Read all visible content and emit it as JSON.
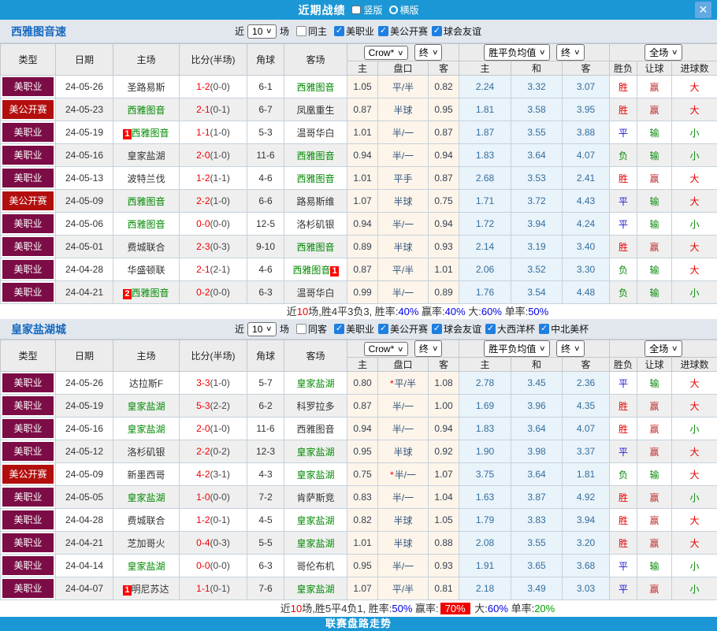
{
  "icons": {
    "chevron": "∨",
    "close": "✕",
    "check": "✓"
  },
  "titlebar": {
    "title": "近期战绩",
    "radios": [
      {
        "label": "竖版",
        "selected": true
      },
      {
        "label": "横版",
        "selected": false
      }
    ]
  },
  "table_header": {
    "main_cols": [
      "类型",
      "日期",
      "主场",
      "比分(半场)",
      "角球",
      "客场"
    ],
    "selects": {
      "crow": "Crow*",
      "crow_end": "终",
      "mean": "胜平负均值",
      "mean_end": "终",
      "full": "全场"
    },
    "sub_cols": [
      "主",
      "盘口",
      "客",
      "主",
      "和",
      "客",
      "胜负",
      "让球",
      "进球数"
    ]
  },
  "outcome_colors": {
    "胜": "red",
    "平": "blue",
    "负": "green",
    "赢": "brick",
    "输": "green",
    "大": "red",
    "小": "green"
  },
  "sections": [
    {
      "team": "西雅图音速",
      "filters": {
        "near": "近",
        "count": "10",
        "unit": "场",
        "same": {
          "label": "同主",
          "checked": false
        },
        "leagues": [
          {
            "label": "美职业",
            "checked": true
          },
          {
            "label": "美公开赛",
            "checked": true
          },
          {
            "label": "球会友谊",
            "checked": true
          }
        ]
      },
      "rows": [
        {
          "type": "美职业",
          "type_style": "maroon",
          "date": "24-05-26",
          "home": {
            "name": "圣路易斯",
            "green": false
          },
          "score": "1-2",
          "half": "(0-0)",
          "corners": "6-1",
          "away": {
            "name": "西雅图音",
            "green": true
          },
          "crow": [
            "1.05",
            "平/半",
            "0.82"
          ],
          "crow_star": false,
          "mean": [
            "2.24",
            "3.32",
            "3.07"
          ],
          "outcome": [
            "胜",
            "赢",
            "大"
          ]
        },
        {
          "type": "美公开赛",
          "type_style": "red",
          "date": "24-05-23",
          "home": {
            "name": "西雅图音",
            "green": true
          },
          "score": "2-1",
          "half": "(0-1)",
          "corners": "6-7",
          "away": {
            "name": "凤凰重生",
            "green": false
          },
          "crow": [
            "0.87",
            "半球",
            "0.95"
          ],
          "crow_star": false,
          "mean": [
            "1.81",
            "3.58",
            "3.95"
          ],
          "outcome": [
            "胜",
            "赢",
            "大"
          ]
        },
        {
          "type": "美职业",
          "type_style": "maroon",
          "date": "24-05-19",
          "home": {
            "name": "西雅图音",
            "green": true,
            "badge": "1",
            "badge_pos": "before"
          },
          "score": "1-1",
          "half": "(1-0)",
          "corners": "5-3",
          "away": {
            "name": "温哥华白",
            "green": false
          },
          "crow": [
            "1.01",
            "半/一",
            "0.87"
          ],
          "crow_star": false,
          "mean": [
            "1.87",
            "3.55",
            "3.88"
          ],
          "outcome": [
            "平",
            "输",
            "小"
          ]
        },
        {
          "type": "美职业",
          "type_style": "maroon",
          "date": "24-05-16",
          "home": {
            "name": "皇家盐湖",
            "green": false
          },
          "score": "2-0",
          "half": "(1-0)",
          "corners": "11-6",
          "away": {
            "name": "西雅图音",
            "green": true
          },
          "crow": [
            "0.94",
            "半/一",
            "0.94"
          ],
          "crow_star": false,
          "mean": [
            "1.83",
            "3.64",
            "4.07"
          ],
          "outcome": [
            "负",
            "输",
            "小"
          ]
        },
        {
          "type": "美职业",
          "type_style": "maroon",
          "date": "24-05-13",
          "home": {
            "name": "波特兰伐",
            "green": false
          },
          "score": "1-2",
          "half": "(1-1)",
          "corners": "4-6",
          "away": {
            "name": "西雅图音",
            "green": true
          },
          "crow": [
            "1.01",
            "平手",
            "0.87"
          ],
          "crow_star": false,
          "mean": [
            "2.68",
            "3.53",
            "2.41"
          ],
          "outcome": [
            "胜",
            "赢",
            "大"
          ]
        },
        {
          "type": "美公开赛",
          "type_style": "red",
          "date": "24-05-09",
          "home": {
            "name": "西雅图音",
            "green": true
          },
          "score": "2-2",
          "half": "(1-0)",
          "corners": "6-6",
          "away": {
            "name": "路易斯维",
            "green": false
          },
          "crow": [
            "1.07",
            "半球",
            "0.75"
          ],
          "crow_star": false,
          "mean": [
            "1.71",
            "3.72",
            "4.43"
          ],
          "outcome": [
            "平",
            "输",
            "大"
          ]
        },
        {
          "type": "美职业",
          "type_style": "maroon",
          "date": "24-05-06",
          "home": {
            "name": "西雅图音",
            "green": true
          },
          "score": "0-0",
          "half": "(0-0)",
          "corners": "12-5",
          "away": {
            "name": "洛杉矶银",
            "green": false
          },
          "crow": [
            "0.94",
            "半/一",
            "0.94"
          ],
          "crow_star": false,
          "mean": [
            "1.72",
            "3.94",
            "4.24"
          ],
          "outcome": [
            "平",
            "输",
            "小"
          ]
        },
        {
          "type": "美职业",
          "type_style": "maroon",
          "date": "24-05-01",
          "home": {
            "name": "费城联合",
            "green": false
          },
          "score": "2-3",
          "half": "(0-3)",
          "corners": "9-10",
          "away": {
            "name": "西雅图音",
            "green": true
          },
          "crow": [
            "0.89",
            "半球",
            "0.93"
          ],
          "crow_star": false,
          "mean": [
            "2.14",
            "3.19",
            "3.40"
          ],
          "outcome": [
            "胜",
            "赢",
            "大"
          ]
        },
        {
          "type": "美职业",
          "type_style": "maroon",
          "date": "24-04-28",
          "home": {
            "name": "华盛顿联",
            "green": false
          },
          "score": "2-1",
          "half": "(2-1)",
          "corners": "4-6",
          "away": {
            "name": "西雅图音",
            "green": true,
            "badge": "1",
            "badge_pos": "after"
          },
          "crow": [
            "0.87",
            "平/半",
            "1.01"
          ],
          "crow_star": false,
          "mean": [
            "2.06",
            "3.52",
            "3.30"
          ],
          "outcome": [
            "负",
            "输",
            "大"
          ]
        },
        {
          "type": "美职业",
          "type_style": "maroon",
          "date": "24-04-21",
          "home": {
            "name": "西雅图音",
            "green": true,
            "badge": "2",
            "badge_pos": "before"
          },
          "score": "0-2",
          "half": "(0-0)",
          "corners": "6-3",
          "away": {
            "name": "温哥华白",
            "green": false
          },
          "crow": [
            "0.99",
            "半/一",
            "0.89"
          ],
          "crow_star": false,
          "mean": [
            "1.76",
            "3.54",
            "4.48"
          ],
          "outcome": [
            "负",
            "输",
            "小"
          ]
        }
      ],
      "summary": [
        {
          "t": "近"
        },
        {
          "t": "10",
          "c": "red"
        },
        {
          "t": "场,胜4平3负3, 胜率:"
        },
        {
          "t": "40%",
          "c": "blue"
        },
        {
          "t": " 赢率:"
        },
        {
          "t": "40%",
          "c": "blue"
        },
        {
          "t": " 大:"
        },
        {
          "t": "60%",
          "c": "blue"
        },
        {
          "t": " 单率:"
        },
        {
          "t": "50%",
          "c": "blue"
        }
      ]
    },
    {
      "team": "皇家盐湖城",
      "filters": {
        "near": "近",
        "count": "10",
        "unit": "场",
        "same": {
          "label": "同客",
          "checked": false
        },
        "leagues": [
          {
            "label": "美职业",
            "checked": true
          },
          {
            "label": "美公开赛",
            "checked": true
          },
          {
            "label": "球会友谊",
            "checked": true
          },
          {
            "label": "大西洋杯",
            "checked": true
          },
          {
            "label": "中北美杯",
            "checked": true
          }
        ]
      },
      "rows": [
        {
          "type": "美职业",
          "type_style": "maroon",
          "date": "24-05-26",
          "home": {
            "name": "达拉斯F",
            "green": false
          },
          "score": "3-3",
          "half": "(1-0)",
          "corners": "5-7",
          "away": {
            "name": "皇家盐湖",
            "green": true
          },
          "crow": [
            "0.80",
            "平/半",
            "1.08"
          ],
          "crow_star": true,
          "mean": [
            "2.78",
            "3.45",
            "2.36"
          ],
          "outcome": [
            "平",
            "输",
            "大"
          ]
        },
        {
          "type": "美职业",
          "type_style": "maroon",
          "date": "24-05-19",
          "home": {
            "name": "皇家盐湖",
            "green": true
          },
          "score": "5-3",
          "half": "(2-2)",
          "corners": "6-2",
          "away": {
            "name": "科罗拉多",
            "green": false
          },
          "crow": [
            "0.87",
            "半/一",
            "1.00"
          ],
          "crow_star": false,
          "mean": [
            "1.69",
            "3.96",
            "4.35"
          ],
          "outcome": [
            "胜",
            "赢",
            "大"
          ]
        },
        {
          "type": "美职业",
          "type_style": "maroon",
          "date": "24-05-16",
          "home": {
            "name": "皇家盐湖",
            "green": true
          },
          "score": "2-0",
          "half": "(1-0)",
          "corners": "11-6",
          "away": {
            "name": "西雅图音",
            "green": false
          },
          "crow": [
            "0.94",
            "半/一",
            "0.94"
          ],
          "crow_star": false,
          "mean": [
            "1.83",
            "3.64",
            "4.07"
          ],
          "outcome": [
            "胜",
            "赢",
            "小"
          ]
        },
        {
          "type": "美职业",
          "type_style": "maroon",
          "date": "24-05-12",
          "home": {
            "name": "洛杉矶银",
            "green": false
          },
          "score": "2-2",
          "half": "(0-2)",
          "corners": "12-3",
          "away": {
            "name": "皇家盐湖",
            "green": true
          },
          "crow": [
            "0.95",
            "半球",
            "0.92"
          ],
          "crow_star": false,
          "mean": [
            "1.90",
            "3.98",
            "3.37"
          ],
          "outcome": [
            "平",
            "赢",
            "大"
          ]
        },
        {
          "type": "美公开赛",
          "type_style": "red",
          "date": "24-05-09",
          "home": {
            "name": "新墨西哥",
            "green": false
          },
          "score": "4-2",
          "half": "(3-1)",
          "corners": "4-3",
          "away": {
            "name": "皇家盐湖",
            "green": true
          },
          "crow": [
            "0.75",
            "半/一",
            "1.07"
          ],
          "crow_star": true,
          "mean": [
            "3.75",
            "3.64",
            "1.81"
          ],
          "outcome": [
            "负",
            "输",
            "大"
          ]
        },
        {
          "type": "美职业",
          "type_style": "maroon",
          "date": "24-05-05",
          "home": {
            "name": "皇家盐湖",
            "green": true
          },
          "score": "1-0",
          "half": "(0-0)",
          "corners": "7-2",
          "away": {
            "name": "肯萨斯竞",
            "green": false
          },
          "crow": [
            "0.83",
            "半/一",
            "1.04"
          ],
          "crow_star": false,
          "mean": [
            "1.63",
            "3.87",
            "4.92"
          ],
          "outcome": [
            "胜",
            "赢",
            "小"
          ]
        },
        {
          "type": "美职业",
          "type_style": "maroon",
          "date": "24-04-28",
          "home": {
            "name": "费城联合",
            "green": false
          },
          "score": "1-2",
          "half": "(0-1)",
          "corners": "4-5",
          "away": {
            "name": "皇家盐湖",
            "green": true
          },
          "crow": [
            "0.82",
            "半球",
            "1.05"
          ],
          "crow_star": false,
          "mean": [
            "1.79",
            "3.83",
            "3.94"
          ],
          "outcome": [
            "胜",
            "赢",
            "大"
          ]
        },
        {
          "type": "美职业",
          "type_style": "maroon",
          "date": "24-04-21",
          "home": {
            "name": "芝加哥火",
            "green": false
          },
          "score": "0-4",
          "half": "(0-3)",
          "corners": "5-5",
          "away": {
            "name": "皇家盐湖",
            "green": true
          },
          "crow": [
            "1.01",
            "半球",
            "0.88"
          ],
          "crow_star": false,
          "mean": [
            "2.08",
            "3.55",
            "3.20"
          ],
          "outcome": [
            "胜",
            "赢",
            "大"
          ]
        },
        {
          "type": "美职业",
          "type_style": "maroon",
          "date": "24-04-14",
          "home": {
            "name": "皇家盐湖",
            "green": true
          },
          "score": "0-0",
          "half": "(0-0)",
          "corners": "6-3",
          "away": {
            "name": "哥伦布机",
            "green": false
          },
          "crow": [
            "0.95",
            "半/一",
            "0.93"
          ],
          "crow_star": false,
          "mean": [
            "1.91",
            "3.65",
            "3.68"
          ],
          "outcome": [
            "平",
            "输",
            "小"
          ]
        },
        {
          "type": "美职业",
          "type_style": "maroon",
          "date": "24-04-07",
          "home": {
            "name": "明尼苏达",
            "green": false,
            "badge": "1",
            "badge_pos": "before"
          },
          "score": "1-1",
          "half": "(0-1)",
          "corners": "7-6",
          "away": {
            "name": "皇家盐湖",
            "green": true
          },
          "crow": [
            "1.07",
            "平/半",
            "0.81"
          ],
          "crow_star": false,
          "mean": [
            "2.18",
            "3.49",
            "3.03"
          ],
          "outcome": [
            "平",
            "赢",
            "小"
          ]
        }
      ],
      "summary": [
        {
          "t": "近"
        },
        {
          "t": "10",
          "c": "red"
        },
        {
          "t": "场,胜5平4负1, 胜率:"
        },
        {
          "t": "50%",
          "c": "blue"
        },
        {
          "t": " 赢率:"
        },
        {
          "t": "70%",
          "c": "white",
          "bg": true
        },
        {
          "t": " 大:"
        },
        {
          "t": "60%",
          "c": "blue"
        },
        {
          "t": " 单率:"
        },
        {
          "t": "20%",
          "c": "green"
        }
      ]
    }
  ],
  "footer": {
    "label": "联赛盘路走势"
  }
}
